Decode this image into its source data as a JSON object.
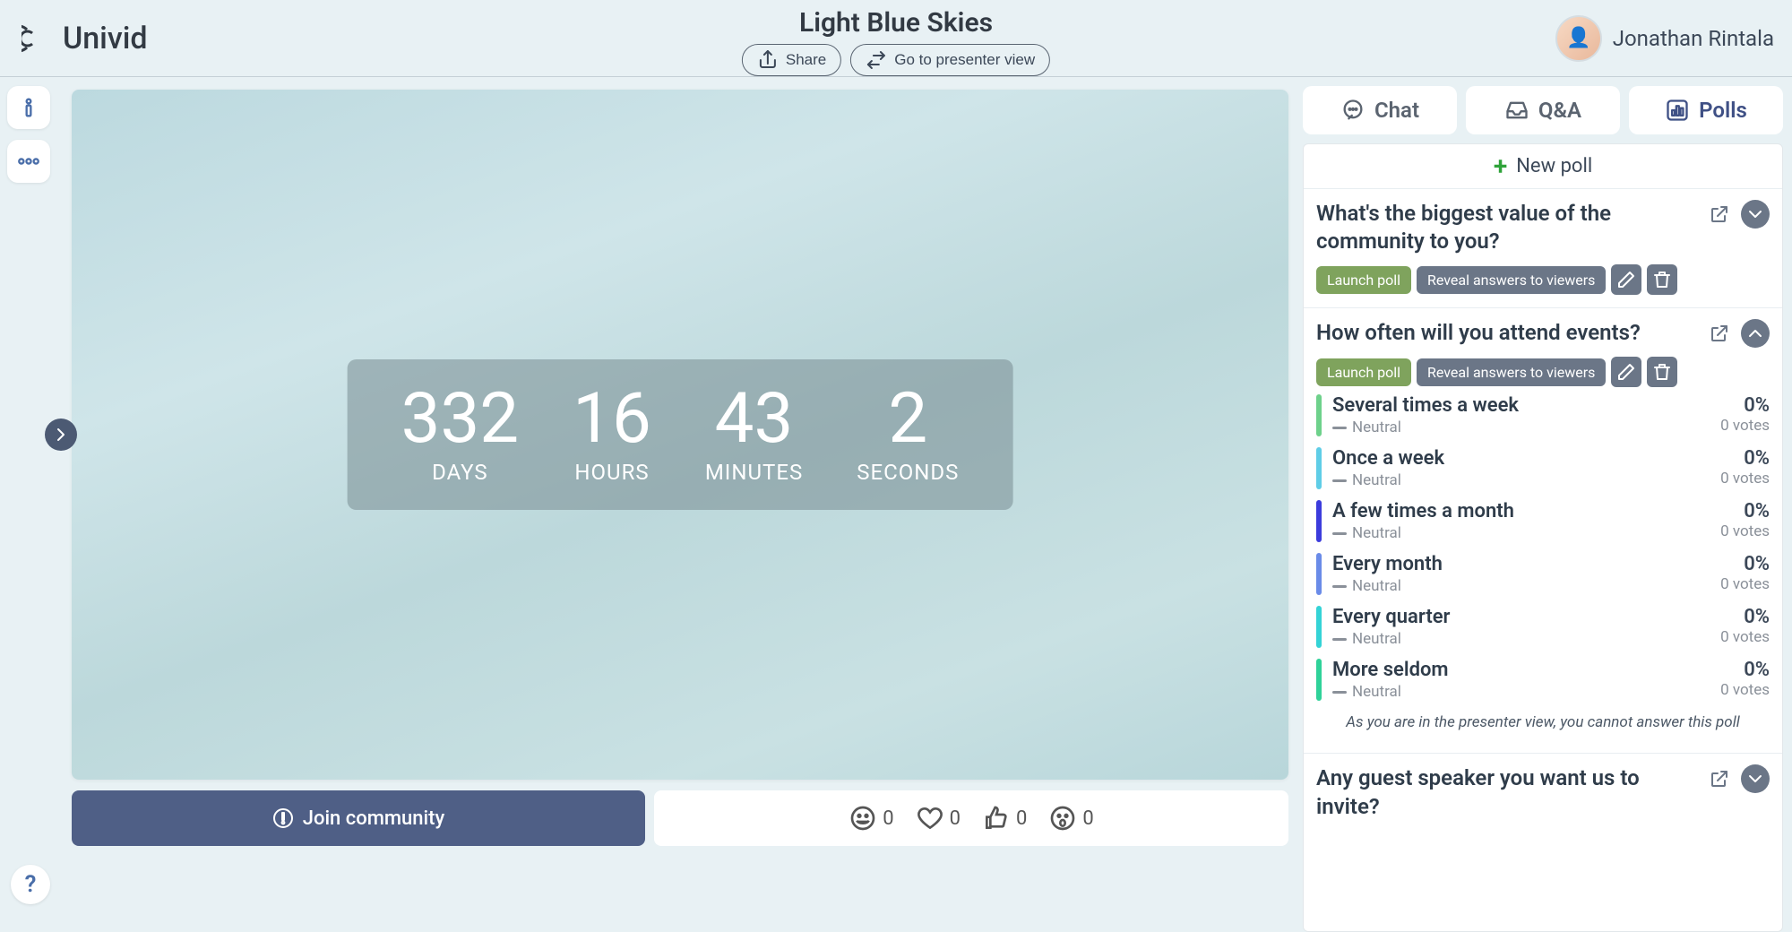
{
  "brand": "Univid",
  "header": {
    "title": "Light Blue Skies",
    "share_label": "Share",
    "presenter_label": "Go to presenter view"
  },
  "user": {
    "name": "Jonathan Rintala"
  },
  "countdown": {
    "days": {
      "value": "332",
      "label": "DAYS"
    },
    "hours": {
      "value": "16",
      "label": "HOURS"
    },
    "minutes": {
      "value": "43",
      "label": "MINUTES"
    },
    "seconds": {
      "value": "2",
      "label": "SECONDS"
    }
  },
  "join_label": "Join community",
  "reactions": {
    "laugh": "0",
    "heart": "0",
    "thumbs": "0",
    "wow": "0"
  },
  "tabs": {
    "chat": "Chat",
    "qa": "Q&A",
    "polls": "Polls"
  },
  "polls_panel": {
    "new_poll": "New poll",
    "launch_label": "Launch poll",
    "reveal_label": "Reveal answers to viewers",
    "neutral_label": "Neutral",
    "presenter_note": "As you are in the presenter view, you cannot answer this poll",
    "polls": [
      {
        "question": "What's the biggest value of the community to you?",
        "expanded": false
      },
      {
        "question": "How often will you attend events?",
        "expanded": true,
        "options": [
          {
            "label": "Several times a week",
            "pct": "0%",
            "votes": "0 votes",
            "color": "#6ed18b"
          },
          {
            "label": "Once a week",
            "pct": "0%",
            "votes": "0 votes",
            "color": "#5fcde7"
          },
          {
            "label": "A few times a month",
            "pct": "0%",
            "votes": "0 votes",
            "color": "#3c3cdc"
          },
          {
            "label": "Every month",
            "pct": "0%",
            "votes": "0 votes",
            "color": "#6a8be8"
          },
          {
            "label": "Every quarter",
            "pct": "0%",
            "votes": "0 votes",
            "color": "#34d3d6"
          },
          {
            "label": "More seldom",
            "pct": "0%",
            "votes": "0 votes",
            "color": "#2fd299"
          }
        ]
      },
      {
        "question": "Any guest speaker you want us to invite?",
        "expanded": false
      }
    ]
  }
}
